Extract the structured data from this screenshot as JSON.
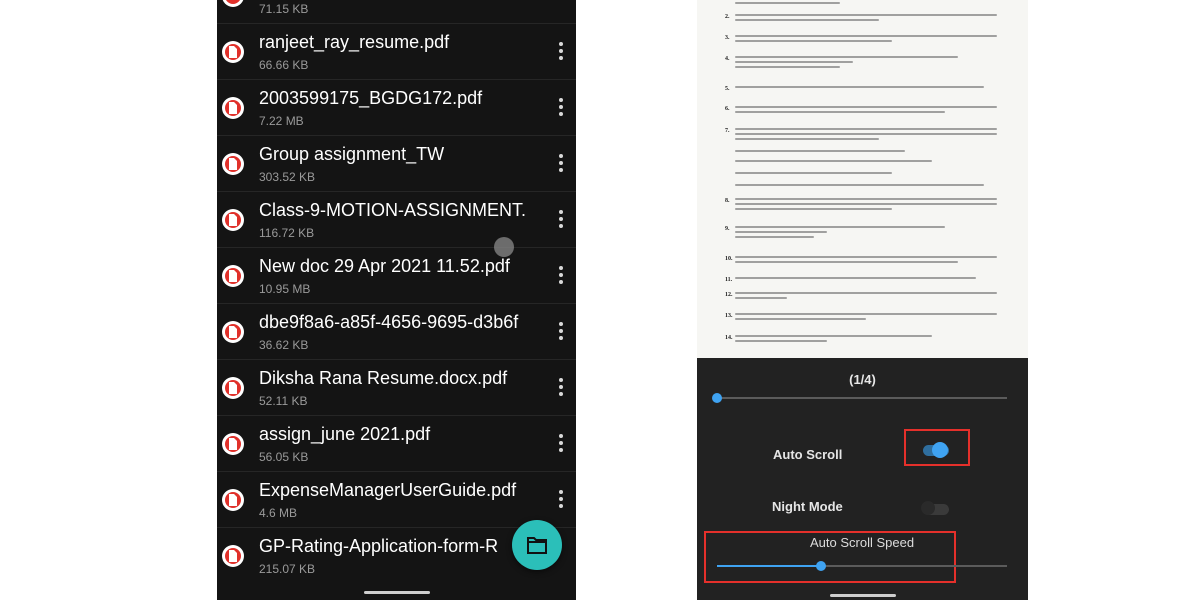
{
  "file_list": {
    "top_partial_size": "71.15 KB",
    "files": [
      {
        "name": "ranjeet_ray_resume.pdf",
        "size": "66.66 KB"
      },
      {
        "name": "2003599175_BGDG172.pdf",
        "size": "7.22 MB"
      },
      {
        "name": "Group assignment_TW",
        "size": "303.52 KB"
      },
      {
        "name": "Class-9-MOTION-ASSIGNMENT.",
        "size": "116.72 KB"
      },
      {
        "name": "New doc 29 Apr 2021 11.52.pdf",
        "size": "10.95 MB"
      },
      {
        "name": "dbe9f8a6-a85f-4656-9695-d3b6f",
        "size": "36.62 KB"
      },
      {
        "name": "Diksha Rana Resume.docx.pdf",
        "size": "52.11 KB"
      },
      {
        "name": "assign_june 2021.pdf",
        "size": "56.05 KB"
      },
      {
        "name": "ExpenseManagerUserGuide.pdf",
        "size": "4.6 MB"
      },
      {
        "name": "GP-Rating-Application-form-R",
        "size": "215.07 KB"
      }
    ],
    "icons": {
      "file": "pdf-file-icon",
      "more": "more-vert-icon",
      "fab": "folder-icon"
    }
  },
  "viewer": {
    "page_indicator": "(1/4)",
    "page_progress": 0.0,
    "auto_scroll": {
      "label": "Auto Scroll",
      "enabled": true
    },
    "night_mode": {
      "label": "Night Mode",
      "enabled": false
    },
    "auto_scroll_speed": {
      "label": "Auto Scroll Speed",
      "value": 0.36
    },
    "accent_color": "#3fa3f2",
    "highlight_color": "#e5302b"
  }
}
